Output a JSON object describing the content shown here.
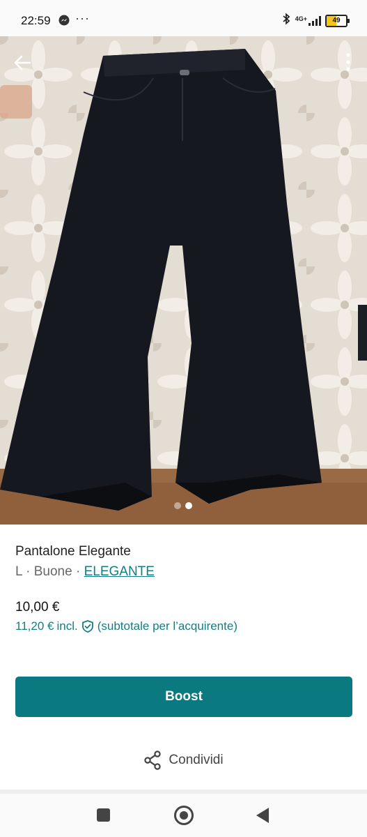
{
  "status_bar": {
    "time": "22:59",
    "dots": "···",
    "network": "4G+",
    "battery": "49"
  },
  "photo": {
    "page_count": 2,
    "active_page": 2
  },
  "item": {
    "title": "Pantalone Elegante",
    "size_condition": "L · Buone · ",
    "brand": "ELEGANTE",
    "price": "10,00 €",
    "buyer_price": "11,20 €",
    "buyer_incl": "incl.",
    "buyer_note": "(subtotale per l’acquirente)"
  },
  "actions": {
    "boost_label": "Boost",
    "share_label": "Condividi"
  },
  "colors": {
    "accent": "#0b7a80",
    "link": "#137d84"
  }
}
